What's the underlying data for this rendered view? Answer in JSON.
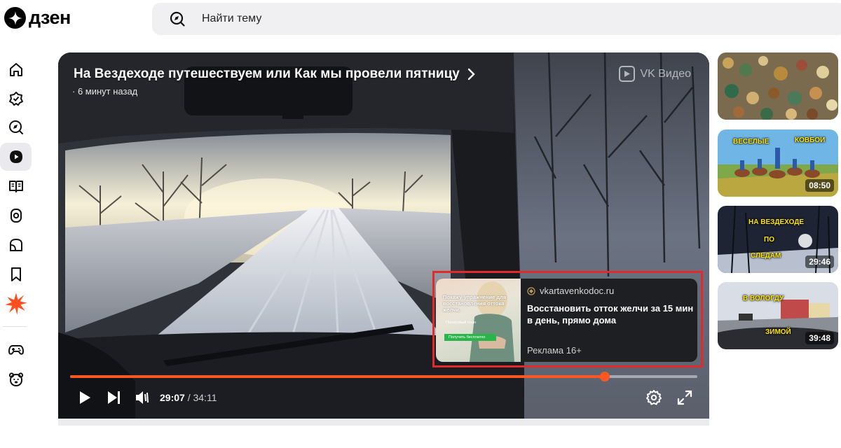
{
  "header": {
    "logo_text": "дзен",
    "search_placeholder": "Найти тему"
  },
  "sidebar": {
    "items": [
      {
        "icon": "home-icon"
      },
      {
        "icon": "subscriptions-icon"
      },
      {
        "icon": "explore-icon"
      },
      {
        "icon": "video-icon",
        "active": true
      },
      {
        "icon": "articles-icon"
      },
      {
        "icon": "shorts-icon"
      },
      {
        "icon": "channels-icon"
      },
      {
        "icon": "bookmark-icon"
      },
      {
        "icon": "burst-icon"
      },
      {
        "icon": "games-icon"
      },
      {
        "icon": "kids-bear-icon"
      }
    ]
  },
  "player": {
    "title": "На Вездеходе путешествуем или Как мы провели пятницу",
    "subtitle": "· 6 минут назад",
    "vk_label": "VK Видео",
    "current_time": "29:07",
    "total_time": " / 34:11",
    "progress": 0.852
  },
  "ad": {
    "image_text": "Покажу упражнение для восстановления оттока желчи.",
    "image_subtext": "Пошаговый план",
    "image_button": "Получить бесплатно",
    "domain": "vkartavenkodoc.ru",
    "headline": "Восстановить отток желчи за 15 мин в день, прямо дома",
    "label": "Реклама 16+"
  },
  "recommendations": [
    {
      "duration": "",
      "overlay": []
    },
    {
      "duration": "08:50",
      "overlay": [
        "ВЕСЕЛЫЕ",
        "КОВБОИ"
      ]
    },
    {
      "duration": "29:46",
      "overlay": [
        "НА ВЕЗДЕХОДЕ",
        "ПО",
        "СЛЕДАМ"
      ]
    },
    {
      "duration": "39:48",
      "overlay": [
        "В ВОЛОГДУ",
        "ЗИМОЙ"
      ]
    }
  ],
  "colors": {
    "accent": "#ff5722",
    "ad_highlight": "#e22a2a",
    "sidebar_active": "#eaeaee"
  }
}
